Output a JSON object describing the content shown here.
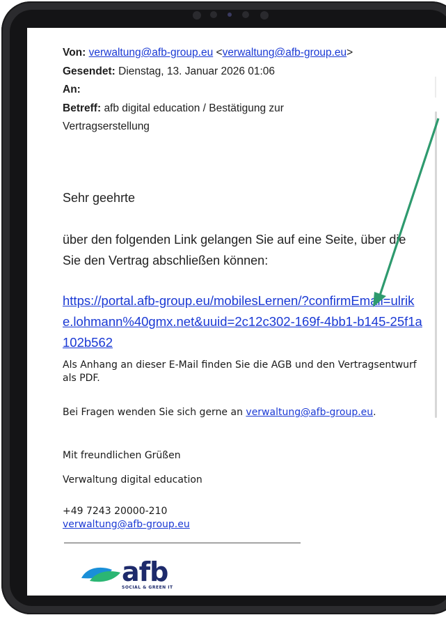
{
  "email": {
    "from_label": "Von:",
    "from_address": "verwaltung@afb-group.eu",
    "from_address_bracket": "verwaltung@afb-group.eu",
    "sent_label": "Gesendet:",
    "sent_value": "Dienstag, 13. Januar 2026 01:06",
    "to_label": "An:",
    "subject_label": "Betreff:",
    "subject_value": "afb digital education / Bestätigung zur Vertragserstellung"
  },
  "body": {
    "greeting": "Sehr geehrte",
    "intro": "über den folgenden Link gelangen Sie auf eine Seite, über die Sie den Vertrag abschließen können:",
    "link_url": "https://portal.afb-group.eu/mobilesLernen/?confirmEmail=ulrike.lohmann%40gmx.net&uuid=2c12c302-169f-4bb1-b145-25f1a102b562",
    "attachment_note": "Als Anhang an dieser E-Mail finden Sie die AGB und den Vertragsentwurf als PDF.",
    "questions_prefix": "Bei Fragen wenden Sie sich gerne an ",
    "questions_email": "verwaltung@afb-group.eu",
    "questions_suffix": ".",
    "closing": "Mit freundlichen Grüßen",
    "signature_name": "Verwaltung digital education",
    "signature_phone": "+49 7243 20000-210",
    "signature_email": "verwaltung@afb-group.eu"
  },
  "logo": {
    "wordmark": "afb",
    "tagline": "SOCIAL & GREEN IT",
    "color_primary": "#1d2a6b",
    "color_green": "#2bb673",
    "color_blue": "#1a8fd8"
  },
  "annotation": {
    "arrow_color": "#2e9a6e",
    "arrow_icon": "arrow-pointing-to-link"
  }
}
